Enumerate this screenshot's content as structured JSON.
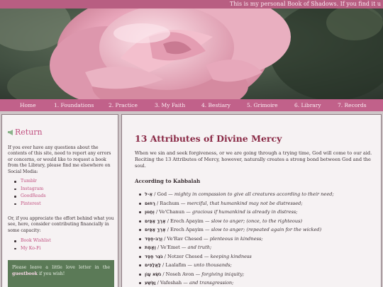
{
  "topbar": {
    "marquee": "This is my personal Book of Shadows. If you find it u"
  },
  "colors": {
    "accent": "#c1618a",
    "link": "#c04f7f",
    "title": "#8a2a46",
    "guest_box": "#5b7a57"
  },
  "header": {
    "image": "pink-rose-photo"
  },
  "nav": {
    "items": [
      {
        "label": "Home"
      },
      {
        "label": "1. Foundations"
      },
      {
        "label": "2. Practice"
      },
      {
        "label": "3. My Faith"
      },
      {
        "label": "4. Bestiary"
      },
      {
        "label": "5. Grimoire"
      },
      {
        "label": "6. Library"
      },
      {
        "label": "7. Records"
      }
    ]
  },
  "sidebar": {
    "return_label": "Return",
    "contact_text": "If you ever have any questions about the contents of this site, need to report any errors or concerns, or would like to request a book from the Library, please find me elsewhere on Social Media:",
    "social_links": [
      "Tumblr",
      "Instagram",
      "GoodReads",
      "Pinterest"
    ],
    "support_text": "Or, if you appreciate the effort behind what you see, here, consider contributing financially in some capacity:",
    "support_links": [
      "Book Wishlist",
      "My Ko-Fi"
    ],
    "guestbook": {
      "before": "Please leave a little love letter in the",
      "link": "guestbook",
      "after": "if you wish!"
    }
  },
  "main": {
    "title": "13 Attributes of Divine Mercy",
    "intro": "When we sin and seek forgiveness, or we are going through a trying time, God will come to our aid. Reciting the 13 Attributes of Mercy, however, naturally creates a strong bond between God and the soul.",
    "subheading": "According to Kabbalah",
    "attributes": [
      {
        "hebrew": "אֵ-ל",
        "name": " / God — ",
        "meaning": "mighty in compassion to give all creatures according to their need;"
      },
      {
        "hebrew": "רַחוּם",
        "name": " / Rachum — ",
        "meaning": "merciful, that humankind may not be distressed;"
      },
      {
        "hebrew": "וְחַנּוּן",
        "name": " / Ve'Chanun — ",
        "meaning": "gracious if humankind is already in distress;"
      },
      {
        "hebrew": "אֶרֶךְ אַפַּיִם",
        "name": " / Erech Apayim — ",
        "meaning": "slow to anger; (once, to the righteous)"
      },
      {
        "hebrew": "אֶרֶךְ אַפַּיִם",
        "name": " / Erech Apayim — ",
        "meaning": "slow to anger; (repeated again for the wicked)"
      },
      {
        "hebrew": "וְרַב-חֶסֶד",
        "name": " / Ve'Rav Chesed — ",
        "meaning": "plenteous in kindness;"
      },
      {
        "hebrew": "וֶאֱמֶת",
        "name": " / Ve'Emet — ",
        "meaning": "and truth;"
      },
      {
        "hebrew": "נֹצֵר חֶסֶד",
        "name": " / Notzer Chesed — ",
        "meaning": "keeping kindness"
      },
      {
        "hebrew": "לָאֲלָפִים",
        "name": " / Laalafim — ",
        "meaning": "unto thousands;"
      },
      {
        "hebrew": "נֹשֵׂא עָוֹן",
        "name": " / Noseh Avon — ",
        "meaning": "forgiving iniquity;"
      },
      {
        "hebrew": "וָפֶשַׁע",
        "name": " / Vafeshah — ",
        "meaning": "and transgression;"
      }
    ]
  }
}
